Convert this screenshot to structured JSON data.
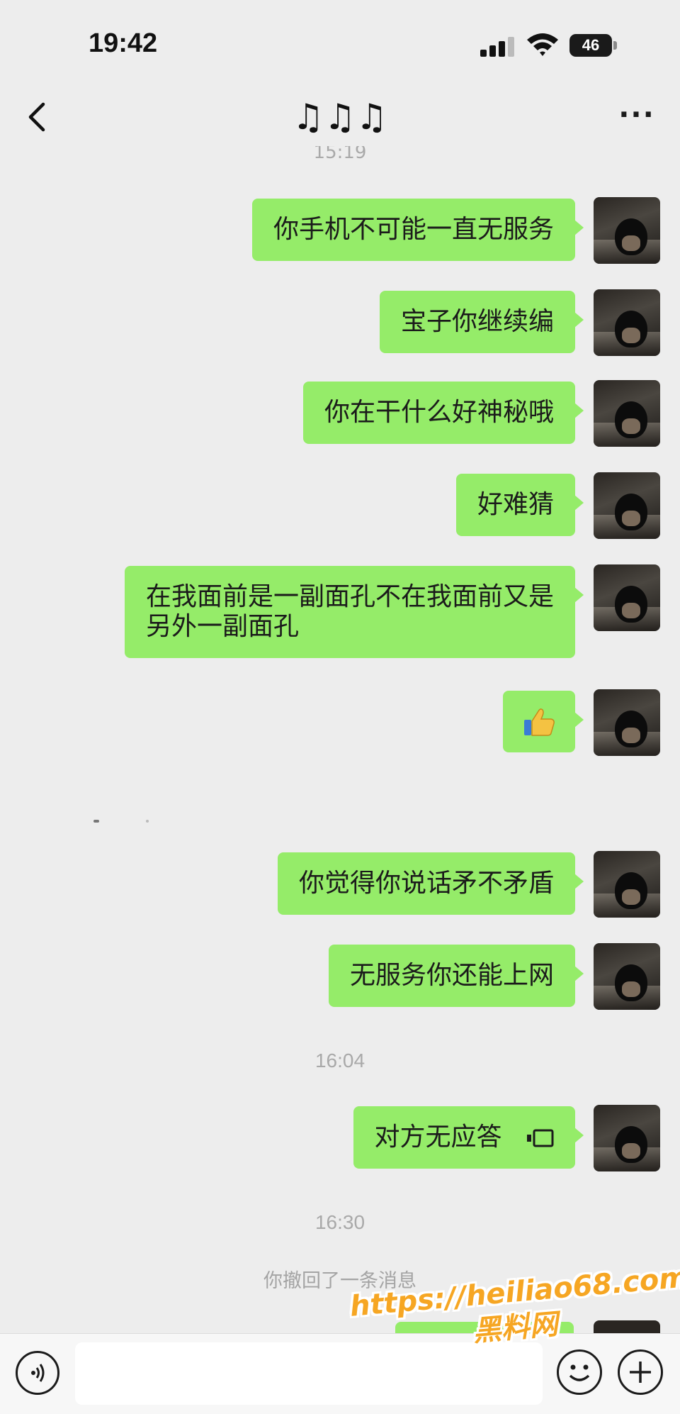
{
  "status_bar": {
    "time": "19:42",
    "battery": "46",
    "signal_icon": "cellular-signal-icon",
    "wifi_icon": "wifi-icon"
  },
  "nav": {
    "title": "♫♫♫",
    "back_icon": "chevron-left-icon",
    "more_label": "···"
  },
  "top_timestamp_fragment": "15:19",
  "messages": [
    {
      "text": "你手机不可能一直无服务"
    },
    {
      "text": "宝子你继续编"
    },
    {
      "text": "你在干什么好神秘哦"
    },
    {
      "text": "好难猜"
    },
    {
      "text": "在我面前是一副面孔不在我面前又是另外一副面孔"
    },
    {
      "emoji": "thumbs-up-icon"
    },
    {
      "text": "你觉得你说话矛不矛盾"
    },
    {
      "text": "无服务你还能上网"
    },
    {
      "text": "对方无应答",
      "icon": "voice-call-icon"
    }
  ],
  "timestamps": [
    "16:04",
    "16:30"
  ],
  "system_note": "你撤回了一条消息",
  "input_bar": {
    "voice_icon": "voice-input-icon",
    "emoji_icon": "emoji-icon",
    "plus_icon": "plus-icon"
  },
  "watermark": {
    "url": "https://heiliao68.com",
    "name": "黑料网"
  },
  "colors": {
    "background": "#ededed",
    "bubble": "#95ec69",
    "watermark": "#f6a623"
  }
}
